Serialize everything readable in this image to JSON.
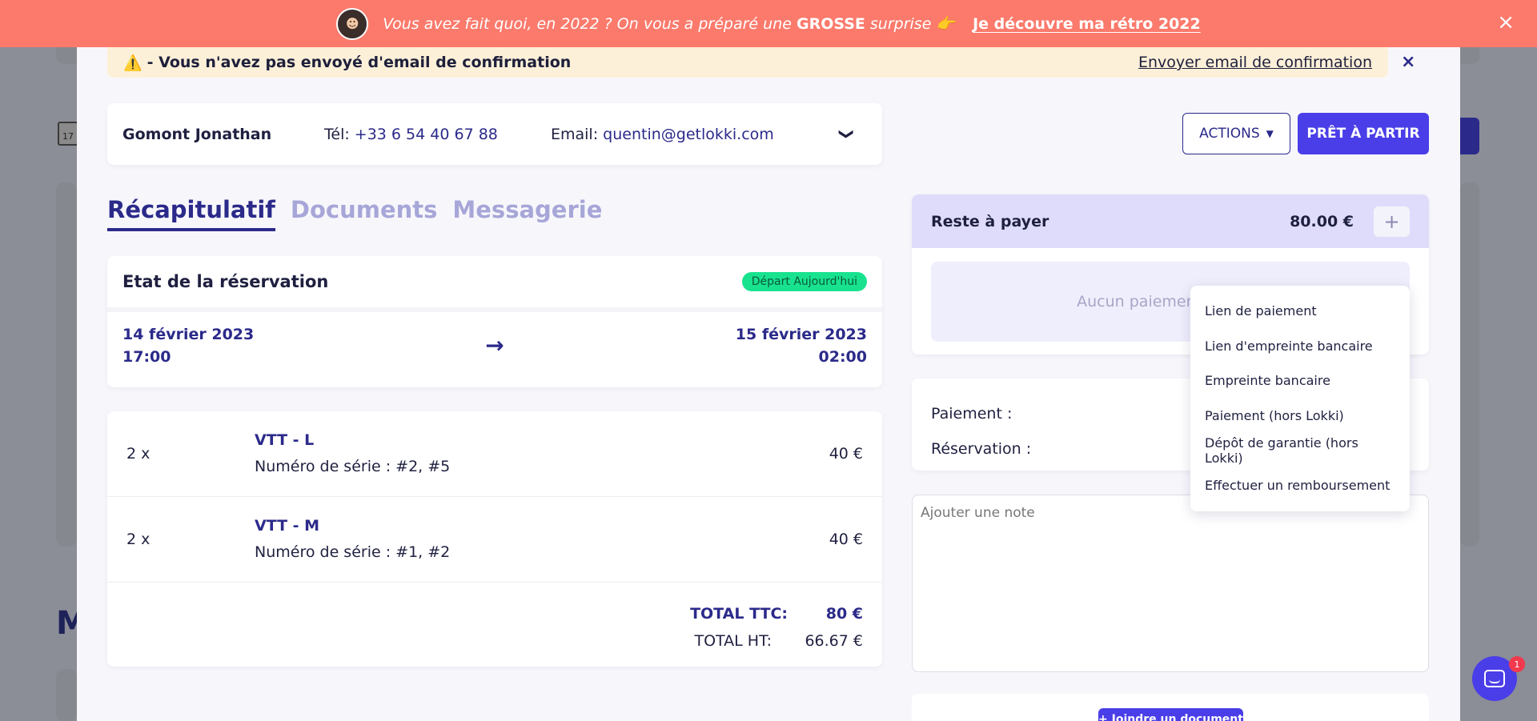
{
  "banner": {
    "avatar_icon": "person-avatar-icon",
    "message_prefix": "Vous avez fait quoi, en 2022 ? On vous a préparé une ",
    "message_bold": "GROSSE",
    "message_suffix": " surprise 👉",
    "cta": "Je découvre ma rétro 2022",
    "close_icon": "×"
  },
  "warning": {
    "icon": "⚠️",
    "text": "- Vous n'avez pas envoyé d'email de confirmation",
    "link": "Envoyer email de confirmation",
    "close": "×"
  },
  "client": {
    "name": "Gomont Jonathan",
    "tel_label": "Tél: ",
    "tel_value": "+33 6 54 40 67 88",
    "email_label": "Email: ",
    "email_value": "quentin@getlokki.com",
    "chevron": "❯"
  },
  "toolbar": {
    "actions_label": "ACTIONS",
    "ready_label": "PRÊT À PARTIR"
  },
  "tabs": [
    {
      "label": "Récapitulatif",
      "active": true
    },
    {
      "label": "Documents",
      "active": false
    },
    {
      "label": "Messagerie",
      "active": false
    }
  ],
  "reservation": {
    "title": "Etat de la réservation",
    "badge": "Départ Aujourd'hui",
    "start_date": "14 février 2023",
    "start_time": "17:00",
    "end_date": "15 février 2023",
    "end_time": "02:00",
    "arrow": "→"
  },
  "items": [
    {
      "qty": "2 x",
      "name": "VTT - L",
      "serial": "Numéro de série : #2, #5",
      "price": "40 €"
    },
    {
      "qty": "2 x",
      "name": "VTT - M",
      "serial": "Numéro de série : #1, #2",
      "price": "40 €"
    }
  ],
  "totals": {
    "ttc_label": "TOTAL TTC:",
    "ttc_value": "80 €",
    "ht_label": "TOTAL HT:",
    "ht_value": "66.67 €"
  },
  "payment": {
    "title": "Reste à payer",
    "amount": "80.00 €",
    "plus": "+",
    "empty": "Aucun paiement e"
  },
  "summary": {
    "payment_label": "Paiement :",
    "reservation_label": "Réservation :"
  },
  "note": {
    "placeholder": "Ajouter une note"
  },
  "attach": {
    "label": "+ Joindre un document"
  },
  "dropdown": {
    "items": [
      "Lien de paiement",
      "Lien d'empreinte bancaire",
      "Empreinte bancaire",
      "Paiement (hors Lokki)",
      "Dépôt de garantie (hors Lokki)",
      "Effectuer un remboursement"
    ]
  },
  "chat": {
    "badge": "1"
  },
  "colors": {
    "banner": "#fb7a6c",
    "primary": "#4a3ee8",
    "navy": "#2b2a8a",
    "badge_green": "#19e28f"
  },
  "background": {
    "icon_text": "17",
    "letter": "M"
  }
}
